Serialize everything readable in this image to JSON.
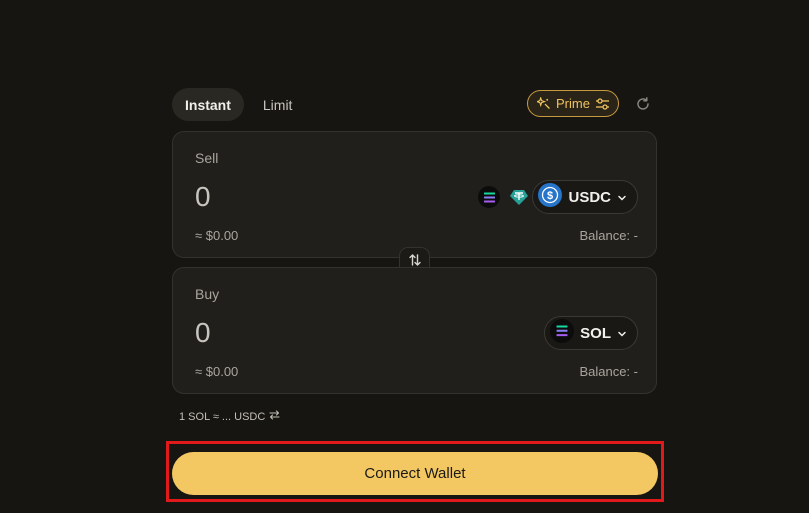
{
  "tabs": [
    {
      "label": "Instant",
      "active": true
    },
    {
      "label": "Limit",
      "active": false
    }
  ],
  "prime": {
    "label": "Prime",
    "icon": "sparkle-icon",
    "settings_icon": "sliders-icon"
  },
  "refresh_icon": "refresh-icon",
  "sell": {
    "label": "Sell",
    "amount": "0",
    "usd_value": "≈ $0.00",
    "balance": "Balance: -",
    "token": "USDC",
    "quick_tokens": [
      "solana-token-icon",
      "usdt-token-icon"
    ]
  },
  "buy": {
    "label": "Buy",
    "amount": "0",
    "usd_value": "≈ $0.00",
    "balance": "Balance: -",
    "token": "SOL"
  },
  "rate": {
    "text": "1 SOL ≈ ... USDC",
    "icon": "swap-horizontal-icon"
  },
  "connect_button": {
    "label": "Connect Wallet"
  },
  "colors": {
    "background": "#171511",
    "panel": "#211f1c",
    "accent": "#f3c862",
    "prime": "#f0c25e",
    "highlight": "#e01a1a",
    "usdc": "#2775ca"
  }
}
